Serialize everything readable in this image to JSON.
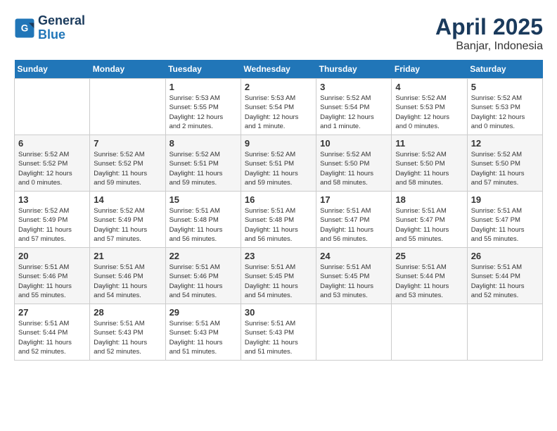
{
  "header": {
    "logo_line1": "General",
    "logo_line2": "Blue",
    "title": "April 2025",
    "subtitle": "Banjar, Indonesia"
  },
  "days_of_week": [
    "Sunday",
    "Monday",
    "Tuesday",
    "Wednesday",
    "Thursday",
    "Friday",
    "Saturday"
  ],
  "weeks": [
    [
      {
        "day": "",
        "info": ""
      },
      {
        "day": "",
        "info": ""
      },
      {
        "day": "1",
        "info": "Sunrise: 5:53 AM\nSunset: 5:55 PM\nDaylight: 12 hours\nand 2 minutes."
      },
      {
        "day": "2",
        "info": "Sunrise: 5:53 AM\nSunset: 5:54 PM\nDaylight: 12 hours\nand 1 minute."
      },
      {
        "day": "3",
        "info": "Sunrise: 5:52 AM\nSunset: 5:54 PM\nDaylight: 12 hours\nand 1 minute."
      },
      {
        "day": "4",
        "info": "Sunrise: 5:52 AM\nSunset: 5:53 PM\nDaylight: 12 hours\nand 0 minutes."
      },
      {
        "day": "5",
        "info": "Sunrise: 5:52 AM\nSunset: 5:53 PM\nDaylight: 12 hours\nand 0 minutes."
      }
    ],
    [
      {
        "day": "6",
        "info": "Sunrise: 5:52 AM\nSunset: 5:52 PM\nDaylight: 12 hours\nand 0 minutes."
      },
      {
        "day": "7",
        "info": "Sunrise: 5:52 AM\nSunset: 5:52 PM\nDaylight: 11 hours\nand 59 minutes."
      },
      {
        "day": "8",
        "info": "Sunrise: 5:52 AM\nSunset: 5:51 PM\nDaylight: 11 hours\nand 59 minutes."
      },
      {
        "day": "9",
        "info": "Sunrise: 5:52 AM\nSunset: 5:51 PM\nDaylight: 11 hours\nand 59 minutes."
      },
      {
        "day": "10",
        "info": "Sunrise: 5:52 AM\nSunset: 5:50 PM\nDaylight: 11 hours\nand 58 minutes."
      },
      {
        "day": "11",
        "info": "Sunrise: 5:52 AM\nSunset: 5:50 PM\nDaylight: 11 hours\nand 58 minutes."
      },
      {
        "day": "12",
        "info": "Sunrise: 5:52 AM\nSunset: 5:50 PM\nDaylight: 11 hours\nand 57 minutes."
      }
    ],
    [
      {
        "day": "13",
        "info": "Sunrise: 5:52 AM\nSunset: 5:49 PM\nDaylight: 11 hours\nand 57 minutes."
      },
      {
        "day": "14",
        "info": "Sunrise: 5:52 AM\nSunset: 5:49 PM\nDaylight: 11 hours\nand 57 minutes."
      },
      {
        "day": "15",
        "info": "Sunrise: 5:51 AM\nSunset: 5:48 PM\nDaylight: 11 hours\nand 56 minutes."
      },
      {
        "day": "16",
        "info": "Sunrise: 5:51 AM\nSunset: 5:48 PM\nDaylight: 11 hours\nand 56 minutes."
      },
      {
        "day": "17",
        "info": "Sunrise: 5:51 AM\nSunset: 5:47 PM\nDaylight: 11 hours\nand 56 minutes."
      },
      {
        "day": "18",
        "info": "Sunrise: 5:51 AM\nSunset: 5:47 PM\nDaylight: 11 hours\nand 55 minutes."
      },
      {
        "day": "19",
        "info": "Sunrise: 5:51 AM\nSunset: 5:47 PM\nDaylight: 11 hours\nand 55 minutes."
      }
    ],
    [
      {
        "day": "20",
        "info": "Sunrise: 5:51 AM\nSunset: 5:46 PM\nDaylight: 11 hours\nand 55 minutes."
      },
      {
        "day": "21",
        "info": "Sunrise: 5:51 AM\nSunset: 5:46 PM\nDaylight: 11 hours\nand 54 minutes."
      },
      {
        "day": "22",
        "info": "Sunrise: 5:51 AM\nSunset: 5:46 PM\nDaylight: 11 hours\nand 54 minutes."
      },
      {
        "day": "23",
        "info": "Sunrise: 5:51 AM\nSunset: 5:45 PM\nDaylight: 11 hours\nand 54 minutes."
      },
      {
        "day": "24",
        "info": "Sunrise: 5:51 AM\nSunset: 5:45 PM\nDaylight: 11 hours\nand 53 minutes."
      },
      {
        "day": "25",
        "info": "Sunrise: 5:51 AM\nSunset: 5:44 PM\nDaylight: 11 hours\nand 53 minutes."
      },
      {
        "day": "26",
        "info": "Sunrise: 5:51 AM\nSunset: 5:44 PM\nDaylight: 11 hours\nand 52 minutes."
      }
    ],
    [
      {
        "day": "27",
        "info": "Sunrise: 5:51 AM\nSunset: 5:44 PM\nDaylight: 11 hours\nand 52 minutes."
      },
      {
        "day": "28",
        "info": "Sunrise: 5:51 AM\nSunset: 5:43 PM\nDaylight: 11 hours\nand 52 minutes."
      },
      {
        "day": "29",
        "info": "Sunrise: 5:51 AM\nSunset: 5:43 PM\nDaylight: 11 hours\nand 51 minutes."
      },
      {
        "day": "30",
        "info": "Sunrise: 5:51 AM\nSunset: 5:43 PM\nDaylight: 11 hours\nand 51 minutes."
      },
      {
        "day": "",
        "info": ""
      },
      {
        "day": "",
        "info": ""
      },
      {
        "day": "",
        "info": ""
      }
    ]
  ]
}
